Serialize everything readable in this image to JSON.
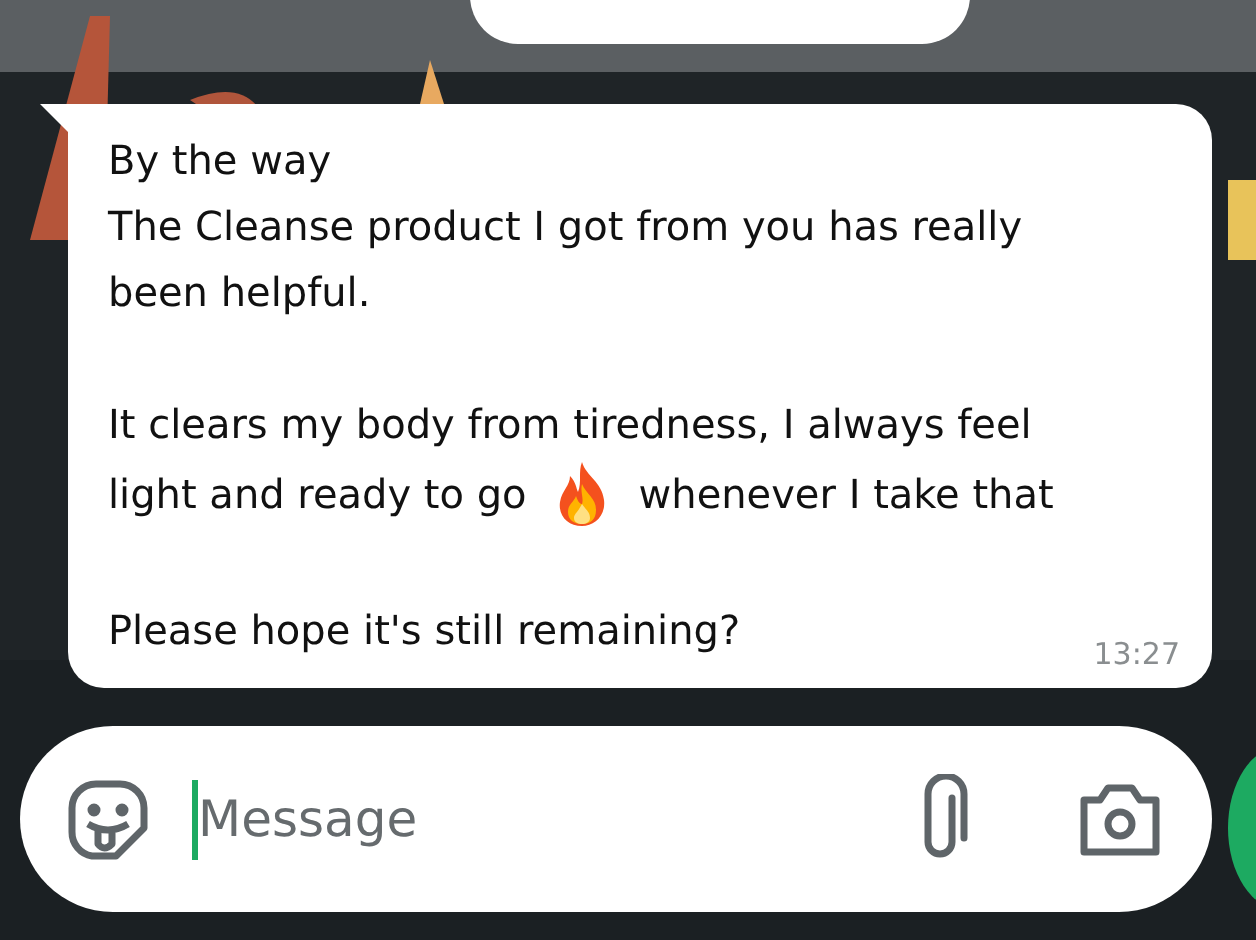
{
  "message": {
    "blocks": [
      {
        "kind": "paragraph",
        "text": "By the way\nThe Cleanse product I got from you has really been helpful."
      },
      {
        "kind": "paragraph",
        "text": "It clears my body from tiredness, I always feel"
      },
      {
        "kind": "emoji_line",
        "before": "light and ready to go",
        "after": "whenever I take that"
      },
      {
        "kind": "paragraph",
        "text": "Please hope it's still remaining?"
      }
    ],
    "time": "13:27"
  },
  "composer": {
    "placeholder": "Message"
  }
}
